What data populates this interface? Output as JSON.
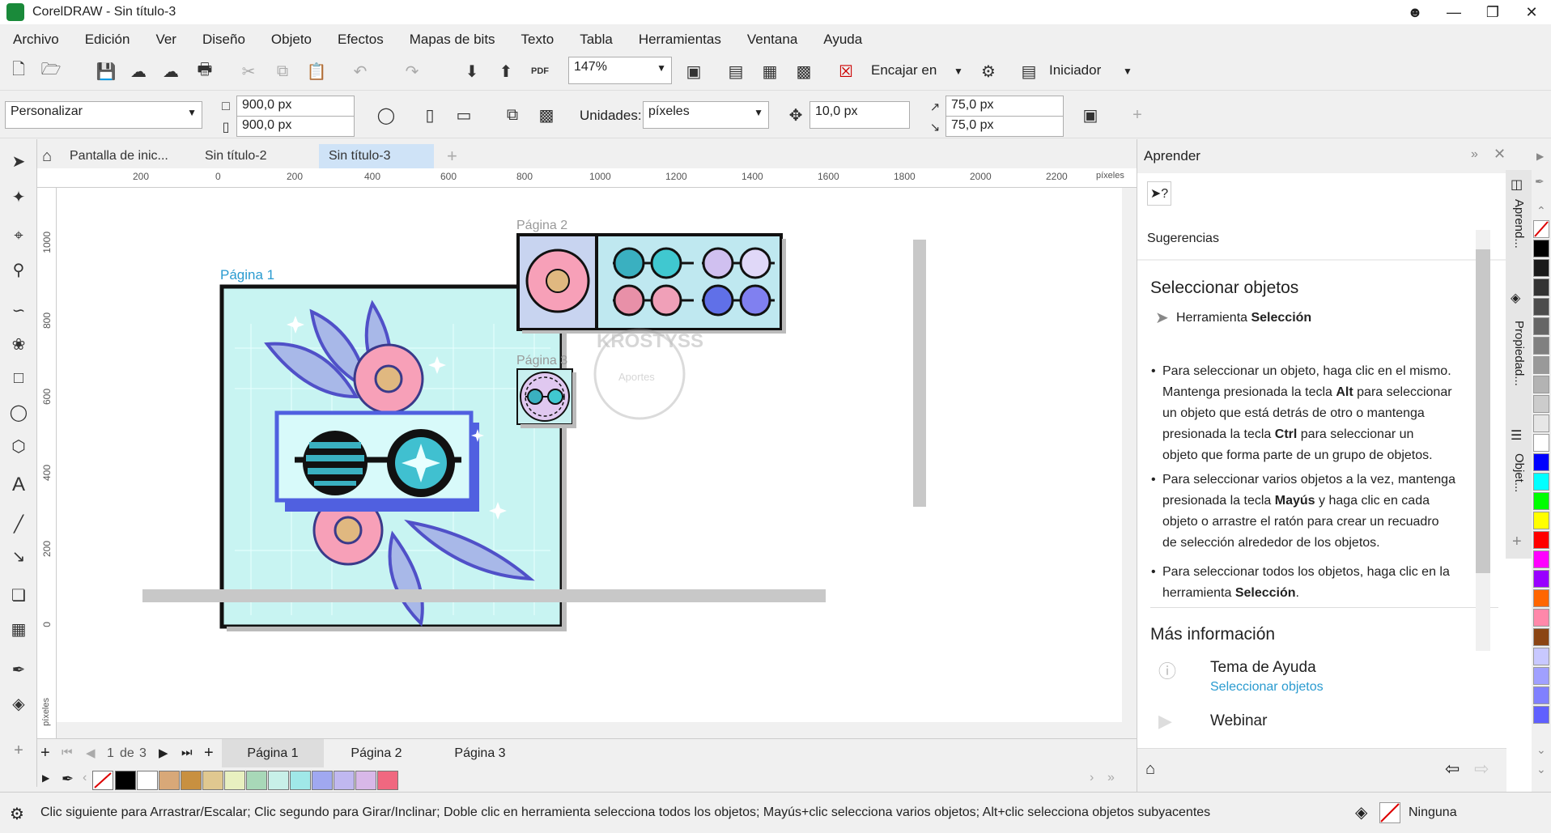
{
  "window": {
    "title": "CorelDRAW - Sin título-3"
  },
  "menu": [
    "Archivo",
    "Edición",
    "Ver",
    "Diseño",
    "Objeto",
    "Efectos",
    "Mapas de bits",
    "Texto",
    "Tabla",
    "Herramientas",
    "Ventana",
    "Ayuda"
  ],
  "toolbar": {
    "zoom": "147%",
    "snap_label": "Encajar en",
    "launcher_label": "Iniciador",
    "pdf_label": "PDF"
  },
  "propbar": {
    "preset": "Personalizar",
    "width": "900,0 px",
    "height": "900,0 px",
    "units_label": "Unidades:",
    "units_value": "píxeles",
    "nudge": "10,0 px",
    "dup_x": "75,0 px",
    "dup_y": "75,0 px"
  },
  "tabs": [
    "Pantalla de inic...",
    "Sin título-2",
    "Sin título-3"
  ],
  "ruler": {
    "h_ticks": [
      "200",
      "0",
      "200",
      "400",
      "600",
      "800",
      "1000",
      "1200",
      "1400",
      "1600",
      "1800",
      "2000",
      "2200"
    ],
    "h_unit": "píxeles",
    "v_ticks": [
      "1000",
      "800",
      "600",
      "400",
      "200",
      "0"
    ],
    "v_unit": "píxeles"
  },
  "canvas": {
    "page1_label": "Página 1",
    "page2_label": "Página 2",
    "page3_label": "Página 3",
    "watermark_main": "KROSTYSS",
    "watermark_sub": "Aportes"
  },
  "pagenav": {
    "current": "1",
    "of": "de",
    "total": "3",
    "pages": [
      "Página 1",
      "Página 2",
      "Página 3"
    ]
  },
  "doc_palette": [
    "#000000",
    "#ffffff",
    "#d8a878",
    "#c89040",
    "#e0c890",
    "#e8f0c0",
    "#a8d8b8",
    "#c8f0e8",
    "#a0e8e8",
    "#a0a8f0",
    "#c0b8f0",
    "#d8b8e8",
    "#f06880"
  ],
  "status": {
    "hint": "Clic siguiente para Arrastrar/Escalar; Clic segundo para Girar/Inclinar; Doble clic en herramienta selecciona todos los objetos; Mayús+clic selecciona varios objetos; Alt+clic selecciona objetos subyacentes",
    "fill": "Ninguna"
  },
  "panel": {
    "title": "Aprender",
    "suggestions": "Sugerencias",
    "heading": "Seleccionar objetos",
    "tool_name_prefix": "Herramienta ",
    "tool_name_bold": "Selección",
    "bullets": [
      {
        "lines": [
          "Para seleccionar un objeto, haga clic en el mismo.",
          "Mantenga presionada la tecla |Alt| para seleccionar",
          "un objeto que está detrás de otro o mantenga",
          "presionada la tecla |Ctrl| para seleccionar un",
          "objeto que forma parte de un grupo de objetos."
        ]
      },
      {
        "lines": [
          "Para seleccionar varios objetos a la vez, mantenga",
          "presionada la tecla |Mayús| y haga clic en cada",
          "objeto o arrastre el ratón para crear un recuadro",
          "de selección alrededor de los objetos."
        ]
      },
      {
        "lines": [
          "Para seleccionar todos los objetos, haga clic en la",
          "herramienta |Selección|."
        ]
      }
    ],
    "more_info": "Más información",
    "help_topic": "Tema de Ayuda",
    "help_link": "Seleccionar objetos",
    "webinar": "Webinar"
  },
  "side_tabs": [
    "Aprend...",
    "Propiedad...",
    "Objet..."
  ],
  "color_strip": [
    "#000000",
    "#1a1a1a",
    "#333333",
    "#4d4d4d",
    "#666666",
    "#808080",
    "#999999",
    "#b3b3b3",
    "#cccccc",
    "#e6e6e6",
    "#ffffff",
    "#0000ff",
    "#00ffff",
    "#00ff00",
    "#ffff00",
    "#ff0000",
    "#ff00ff",
    "#9900ff",
    "#ff6600",
    "#ff88aa",
    "#8b4513",
    "#c8c8ff",
    "#a0a0ff",
    "#8080ff",
    "#6060ff"
  ]
}
